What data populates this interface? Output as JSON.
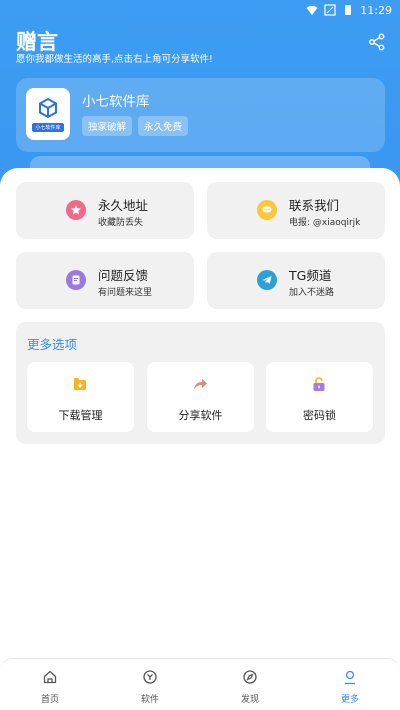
{
  "status_bar": {
    "time": "11:29"
  },
  "header": {
    "title": "赠言",
    "subtitle": "愿你我都做生活的高手,点击右上角可分享软件!"
  },
  "app_card": {
    "name": "小七软件库",
    "logo_caption": "小七软件库",
    "tags": [
      "独家破解",
      "永久免费"
    ]
  },
  "tiles": [
    {
      "title": "永久地址",
      "desc": "收藏防丢失",
      "icon": "star-icon",
      "color": "#f06a8c"
    },
    {
      "title": "联系我们",
      "desc": "电报: @xiaoqirjk",
      "icon": "chat-icon",
      "color": "#f6c83a"
    },
    {
      "title": "问题反馈",
      "desc": "有问题来这里",
      "icon": "feedback-icon",
      "color": "#9a7ae0"
    },
    {
      "title": "TG频道",
      "desc": "加入不迷路",
      "icon": "telegram-icon",
      "color": "#2f9fd8"
    }
  ],
  "more": {
    "title": "更多选项",
    "items": [
      {
        "label": "下载管理",
        "icon": "download-icon",
        "color": "#f4b521"
      },
      {
        "label": "分享软件",
        "icon": "share-arrow-icon",
        "color": "#e08a78"
      },
      {
        "label": "密码锁",
        "icon": "lock-icon",
        "color": "#a77be6"
      }
    ]
  },
  "nav": [
    {
      "label": "首页",
      "icon": "home-icon"
    },
    {
      "label": "软件",
      "icon": "software-icon"
    },
    {
      "label": "发现",
      "icon": "compass-icon"
    },
    {
      "label": "更多",
      "icon": "person-icon",
      "active": true
    }
  ],
  "colors": {
    "primary": "#3d9df3",
    "accent": "#3a8ef0",
    "tile_bg": "#f1f1f1"
  }
}
